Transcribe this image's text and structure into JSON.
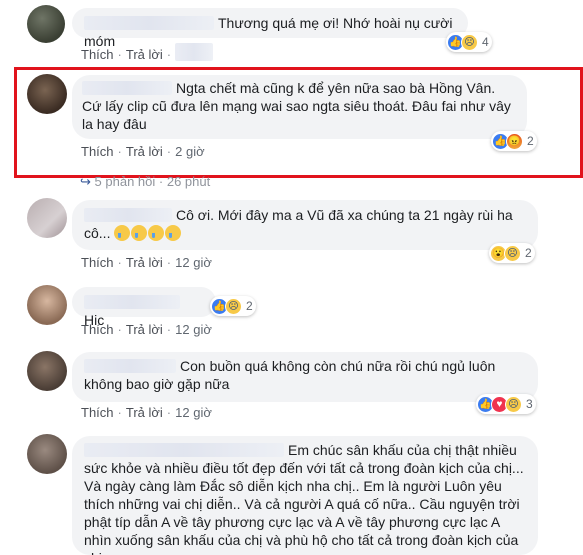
{
  "labels": {
    "like": "Thích",
    "reply": "Trả lời",
    "sep": "·"
  },
  "comments": [
    {
      "text": "Thương quá mẹ ơi! Nhớ hoài nụ cười móm",
      "time": "",
      "reactions": [
        "like-icon",
        "sad-icon"
      ],
      "count": "4"
    },
    {
      "text": "Ngta chết mà cũng k để yên nữa sao bà Hồng Vân. Cứ lấy clip cũ đưa lên mạng wai sao ngta siêu thoát. Đâu fai như vây la hay đâu",
      "time": "2 giờ",
      "reactions": [
        "like-icon",
        "angry-icon"
      ],
      "count": "2"
    },
    {
      "text": "Cô ơi. Mới đây ma a Vũ đã xa chúng ta 21 ngày rùi ha cô...",
      "time": "12 giờ",
      "reactions": [
        "wow-icon",
        "sad-icon"
      ],
      "count": "2"
    },
    {
      "text": "Hic",
      "time": "12 giờ",
      "reactions": [
        "like-icon",
        "sad-icon"
      ],
      "count": "2"
    },
    {
      "text": "Con buồn quá không còn chú nữa rồi chú ngủ luôn không bao giờ gặp nữa",
      "time": "12 giờ",
      "reactions": [
        "like-icon",
        "love-icon",
        "sad-icon"
      ],
      "count": "3"
    },
    {
      "text": "Em chúc sân khấu của chị thật nhiều sức khỏe và nhiều điều tốt đẹp đến với tất cả trong đoàn kịch của chị... Và ngày càng làm Đắc sô diễn kịch nha chị.. Em là người Luôn yêu thích những vai chị diễn.. Và cả người A quá cố nữa.. Cầu nguyện trời phật típ dẫn A về tây phương cực lạc và A về tây phương cực lạc A nhìn xuống sân khấu của chị và phù hộ cho tất cả trong đoàn kịch của chị"
    }
  ],
  "reply_summary": {
    "text": "5 phản hồi",
    "time": "26 phút"
  },
  "colors": {
    "highlight": "#e1131c",
    "bubble": "#f2f3f5",
    "link": "#4b4f56"
  }
}
